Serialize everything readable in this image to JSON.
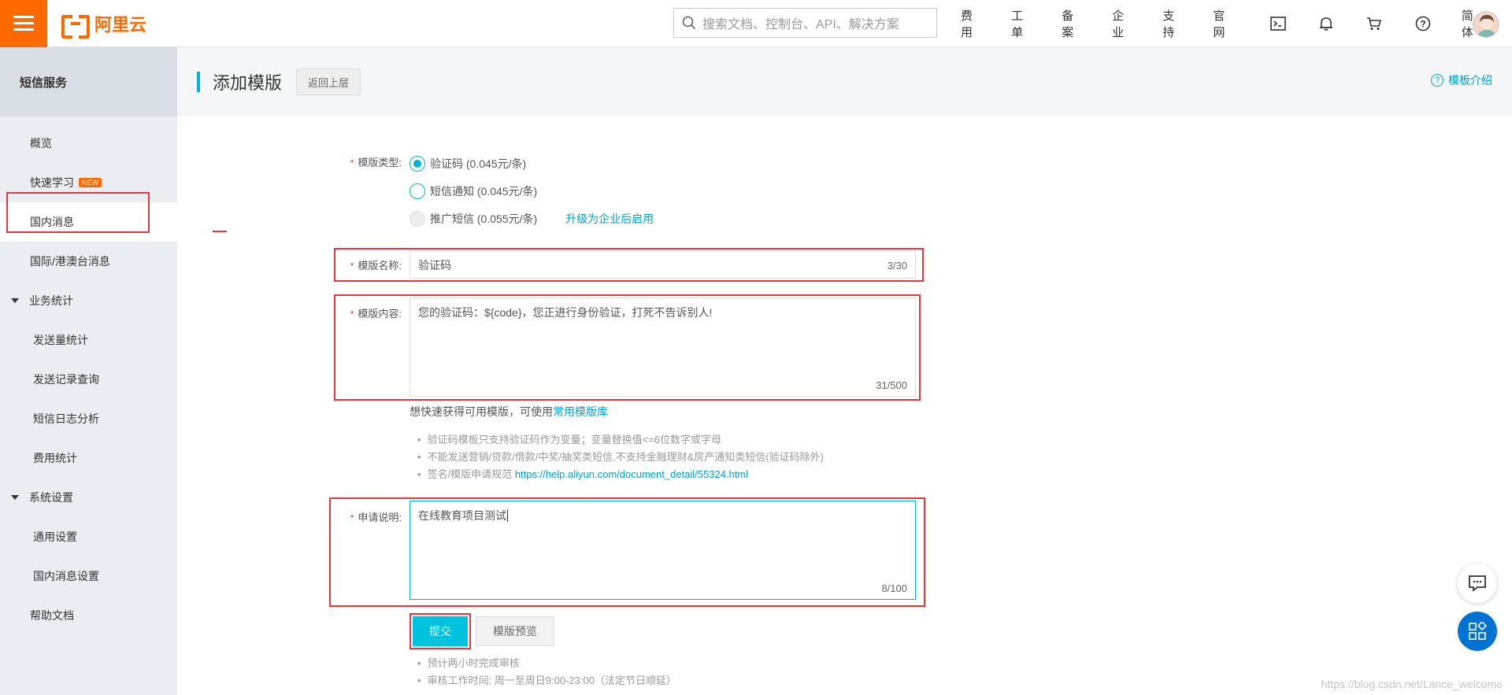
{
  "brand": {
    "logo_text": "阿里云",
    "accent": "#ff6a00"
  },
  "search": {
    "placeholder": "搜索文档、控制台、API、解决方案"
  },
  "nav": {
    "items": [
      "费用",
      "工单",
      "备案",
      "企业",
      "支持",
      "官网"
    ],
    "lang": "简体",
    "icons": [
      "terminal-icon",
      "bell-icon",
      "cart-icon",
      "help-icon"
    ]
  },
  "sidebar": {
    "title": "短信服务",
    "items": [
      {
        "label": "概览"
      },
      {
        "label": "快速学习",
        "badge": "NEW"
      },
      {
        "label": "国内消息"
      },
      {
        "label": "国际/港澳台消息"
      },
      {
        "label": "业务统计"
      },
      {
        "label": "发送量统计"
      },
      {
        "label": "发送记录查询"
      },
      {
        "label": "短信日志分析"
      },
      {
        "label": "费用统计"
      },
      {
        "label": "系统设置"
      },
      {
        "label": "通用设置"
      },
      {
        "label": "国内消息设置"
      },
      {
        "label": "帮助文档"
      }
    ]
  },
  "page": {
    "title": "添加模版",
    "back_label": "返回上层",
    "help_link": "模板介绍"
  },
  "form": {
    "type_label": "模版类型:",
    "type_options": [
      {
        "label": "验证码 (0.045元/条)",
        "checked": true
      },
      {
        "label": "短信通知 (0.045元/条)",
        "checked": false
      },
      {
        "label": "推广短信 (0.055元/条)",
        "checked": false,
        "disabled": true
      }
    ],
    "upgrade_link": "升级为企业后启用",
    "name_label": "模版名称:",
    "name_value": "验证码",
    "name_counter": "3/30",
    "content_label": "模版内容:",
    "content_value": "您的验证码：${code}，您正进行身份验证，打死不告诉别人!",
    "content_counter": "31/500",
    "quick_hint": "想快速获得可用模版，可使用",
    "quick_link": "常用模版库",
    "notes": [
      "验证码模板只支持验证码作为变量；变量替换值<=6位数字或字母",
      "不能发送营销/贷款/借款/中奖/抽奖类短信,不支持金融理财&房产通知类短信(验证码除外)"
    ],
    "note3_prefix": "签名/模版申请规范",
    "note3_link": "https://help.aliyun.com/document_detail/55324.html",
    "apply_label": "申请说明:",
    "apply_value": "在线教育项目测试",
    "apply_counter": "8/100",
    "submit_label": "提交",
    "preview_label": "模版预览",
    "footer_notes": [
      "预计两小时完成审核",
      "审核工作时间: 周一至周日9:00-23:00（法定节日顺延）"
    ]
  },
  "watermark": "https://blog.csdn.net/Lance_welcome",
  "colors": {
    "primary": "#00c1de",
    "highlight": "#e4393c",
    "link": "#00a2ca"
  }
}
